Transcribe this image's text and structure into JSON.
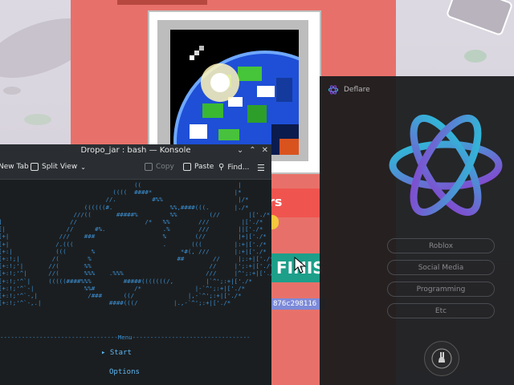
{
  "konsole": {
    "title": "Dropo_jar : bash — Konsole",
    "toolbar": {
      "new_tab": "New Tab",
      "split_view": "Split View",
      "copy": "Copy",
      "paste": "Paste",
      "find": "Find..."
    },
    "ascii_art": "                                      ((                           |\n                                ((((  ####*                       |*\n                              //.          #%%                     |/*\n                        ((((((#.                %%,####(((.       |./*\n                     ///((       #####%         %%         (//        |['./*\n]                   //                   /*   %%        ///         |['./*\n[|                 //      #%.                .%        ///        ||['./*\n[+|              ///    ###                   %        (//         |+|['./*\n[+|             /.(((                         .       (((         |:+|['./*\n[+:|            (((       %                        *#(, ///       |:+|['./*\n[+:!;|         /(        %                        ##        //     |;:+|['./*\n[+:!;'|       //(       %%                                 //     |';:+|['./*\n[+:!;'^|      //(       %%%    .%%%                       ///     |^';:+|['./*\n[+:!;'^`|     (((((####%%%         #####(((((((/,         |`^';:+|['./*\n[+:!;'^`-|              %%#           /*               |-`^';:+|['./*\n[+:!;'^`-,|              /###      ((/               |,-`^';:+|['./*\n[+:!;'^`-,.|                   ####(((/          |.,-`^';:+|['./*",
    "menu_rule": "---------------------------------Menu---------------------------------",
    "menu_start": "Start",
    "menu_options": "Options"
  },
  "game": {
    "hash_text": "876c298116",
    "finish_text": "FINIS",
    "overlay_text": "rs"
  },
  "deflare": {
    "title": "Deflare",
    "buttons": [
      "Roblox",
      "Social Media",
      "Programming",
      "Etc"
    ]
  },
  "colors": {
    "panel_red": "#e7716a",
    "finish_teal": "#1d9f8a",
    "terminal_blue": "#3b8fd2",
    "deflare_cyan": "#27c4d8",
    "deflare_purple": "#8a3fcf"
  },
  "icons": [
    "split-view-icon",
    "copy-icon",
    "paste-icon",
    "find-icon",
    "hamburger-menu-icon",
    "minimize-icon",
    "maximize-icon",
    "close-icon",
    "deflare-logo-icon",
    "terminal-prompt-icon",
    "mouse-cursor-icon"
  ]
}
